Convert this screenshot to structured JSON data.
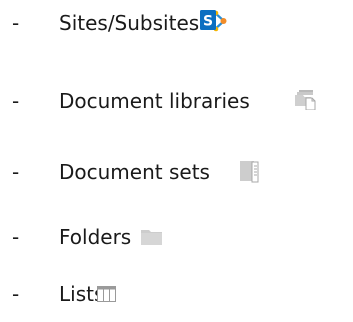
{
  "list": {
    "bullet": "-",
    "items": [
      {
        "label": "Sites/Subsites",
        "icon": "sharepoint-site-icon"
      },
      {
        "label": "Document libraries",
        "icon": "document-library-icon"
      },
      {
        "label": "Document sets",
        "icon": "document-set-icon"
      },
      {
        "label": "Folders",
        "icon": "folder-icon"
      },
      {
        "label": "Lists",
        "icon": "list-icon"
      }
    ]
  },
  "colors": {
    "text": "#1a1a1a",
    "sharepoint_blue": "#0b6fc1",
    "icon_gray": "#c4c4c4"
  }
}
